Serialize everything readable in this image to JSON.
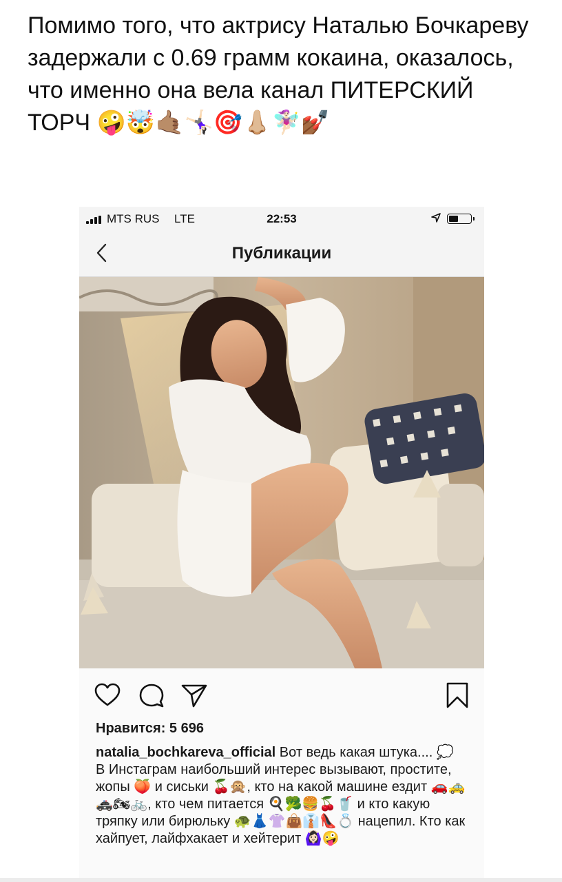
{
  "post": {
    "text": "Помимо того, что актрису Наталью Бочкареву задержали с 0.69 грамм кокаина, оказалось, что именно она вела канал ПИТЕРСКИЙ ТОРЧ 🤪🤯🤙🏽🤸🏻‍♀️🎯👃🏼🧚🏻‍♀️💅🏾"
  },
  "status_bar": {
    "carrier": "MTS RUS",
    "network": "LTE",
    "time": "22:53",
    "battery_level": 0.45
  },
  "nav": {
    "title": "Публикации",
    "back_icon": "chevron-left-icon"
  },
  "actions": {
    "like_icon": "heart-icon",
    "comment_icon": "comment-icon",
    "share_icon": "send-icon",
    "save_icon": "bookmark-icon"
  },
  "likes": {
    "text": "Нравится: 5 696"
  },
  "caption": {
    "username": "natalia_bochkareva_official",
    "first_line": "Вот ведь какая штука.... 💭",
    "body": "В Инстаграм наибольший интерес вызывают, простите, жопы 🍑 и сиськи 🍒🙊, кто на какой машине ездит 🚗🚕🚓🏍🚲, кто чем питается 🍳🥦🍔🍒🥤 и кто какую тряпку или бирюльку 🐢👗👚👜👔👠💍 нацепил. Кто как хайпует, лайфхакает и хейтерит 🙆🏻‍♀️🤪"
  },
  "colors": {
    "text": "#111111",
    "statusbar_bg": "#f4f4f4"
  }
}
